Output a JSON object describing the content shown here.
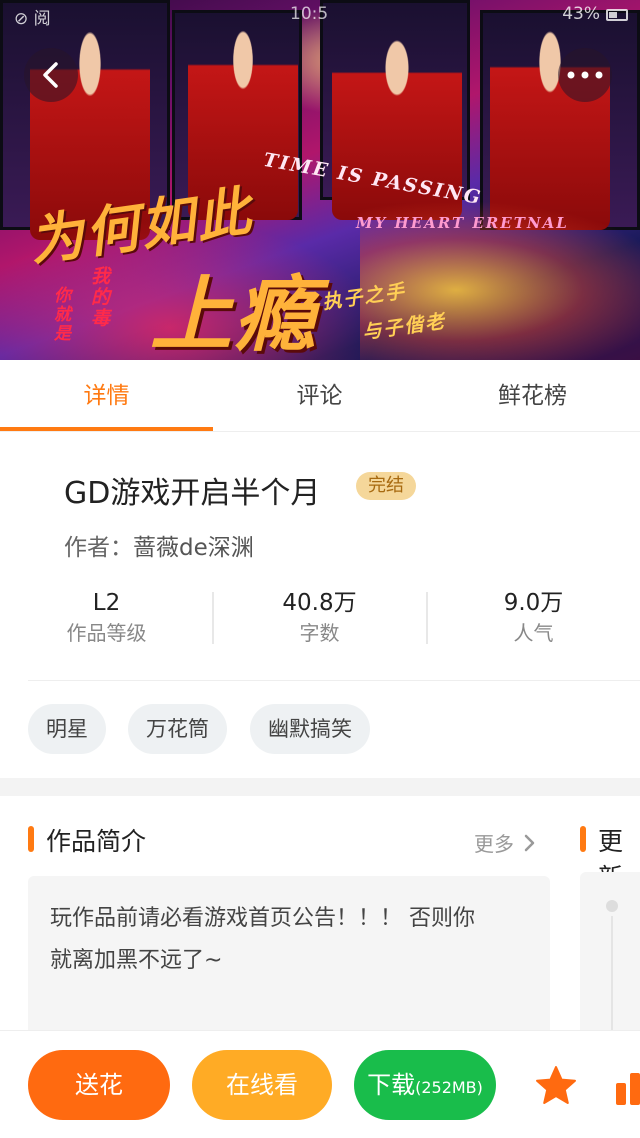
{
  "status_bar": {
    "left": "⊘ 阅",
    "time": "10:5",
    "battery": "43%"
  },
  "hero": {
    "text_time": "TIME IS PASSING",
    "text_heart": "MY HEART ERETNAL",
    "text_big1": "为何如此",
    "text_big2": "上瘾",
    "text_small1": "你就是",
    "text_small2": "我的毒",
    "text_small3": "执子之手",
    "text_small4": "与子偕老"
  },
  "nav": {
    "back_icon": "chevron-left-icon",
    "more_icon": "ellipsis-icon"
  },
  "tabs": [
    {
      "label": "详情",
      "active": true
    },
    {
      "label": "评论",
      "active": false
    },
    {
      "label": "鲜花榜",
      "active": false
    }
  ],
  "work": {
    "title": "GD游戏开启半个月",
    "status_badge": "完结",
    "author_label": "作者：",
    "author_name": "蔷薇de深渊"
  },
  "stats": [
    {
      "value": "L2",
      "label": "作品等级"
    },
    {
      "value": "40.8万",
      "label": "字数"
    },
    {
      "value": "9.0万",
      "label": "人气"
    }
  ],
  "tags": [
    "明星",
    "万花筒",
    "幽默搞笑"
  ],
  "intro": {
    "title": "作品简介",
    "more": "更多",
    "text_line1": "玩作品前请必看游戏首页公告！！！ 否则你",
    "text_line2": "就离加黑不远了~",
    "next_section_title": "更新"
  },
  "actions": {
    "flower": "送花",
    "read_online": "在线看",
    "download": "下载",
    "download_size": "(252MB)",
    "favorite_icon": "star-icon",
    "rank_icon": "bar-chart-icon"
  },
  "colors": {
    "accent": "#ff7a12",
    "flower": "#ff6a10",
    "read": "#ffab25",
    "download": "#19bd4b"
  }
}
